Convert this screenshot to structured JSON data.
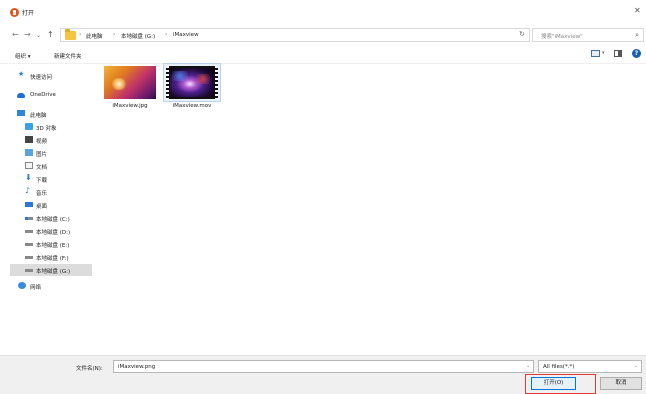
{
  "window": {
    "title": "打开"
  },
  "nav": {
    "back": "←",
    "forward": "→",
    "dropdown": "⌄",
    "up": "↑",
    "breadcrumb": [
      "此电脑",
      "本地磁盘 (G:)",
      "iMaxview"
    ],
    "breadcrumb_sep": "›",
    "refresh": "↻",
    "search_placeholder": "搜索\"iMaxview\""
  },
  "toolbar": {
    "organize": "组织 ▾",
    "new_folder": "新建文件夹"
  },
  "sidebar": {
    "items": [
      {
        "label": "快速访问",
        "icon": "star-icon"
      },
      {
        "label": "OneDrive",
        "icon": "cloud-icon"
      },
      {
        "label": "此电脑",
        "icon": "computer-icon"
      },
      {
        "label": "3D 对象",
        "icon": "cube-icon"
      },
      {
        "label": "视频",
        "icon": "video-icon"
      },
      {
        "label": "图片",
        "icon": "picture-icon"
      },
      {
        "label": "文档",
        "icon": "document-icon"
      },
      {
        "label": "下载",
        "icon": "download-icon"
      },
      {
        "label": "音乐",
        "icon": "music-icon"
      },
      {
        "label": "桌面",
        "icon": "desktop-icon"
      },
      {
        "label": "本地磁盘 (C:)",
        "icon": "system-drive-icon"
      },
      {
        "label": "本地磁盘 (D:)",
        "icon": "drive-icon"
      },
      {
        "label": "本地磁盘 (E:)",
        "icon": "drive-icon"
      },
      {
        "label": "本地磁盘 (F:)",
        "icon": "drive-icon"
      },
      {
        "label": "本地磁盘 (G:)",
        "icon": "drive-icon",
        "selected": true
      },
      {
        "label": "网络",
        "icon": "network-icon"
      }
    ]
  },
  "files": [
    {
      "name": "iMaxview.jpg",
      "kind": "image"
    },
    {
      "name": "iMaxview.mov",
      "kind": "video",
      "selected": true
    }
  ],
  "footer": {
    "filename_label": "文件名(N):",
    "filename_value": "iMaxview.png",
    "filetype_value": "All files(*.*)",
    "open_label": "打开(O)",
    "cancel_label": "取消"
  }
}
